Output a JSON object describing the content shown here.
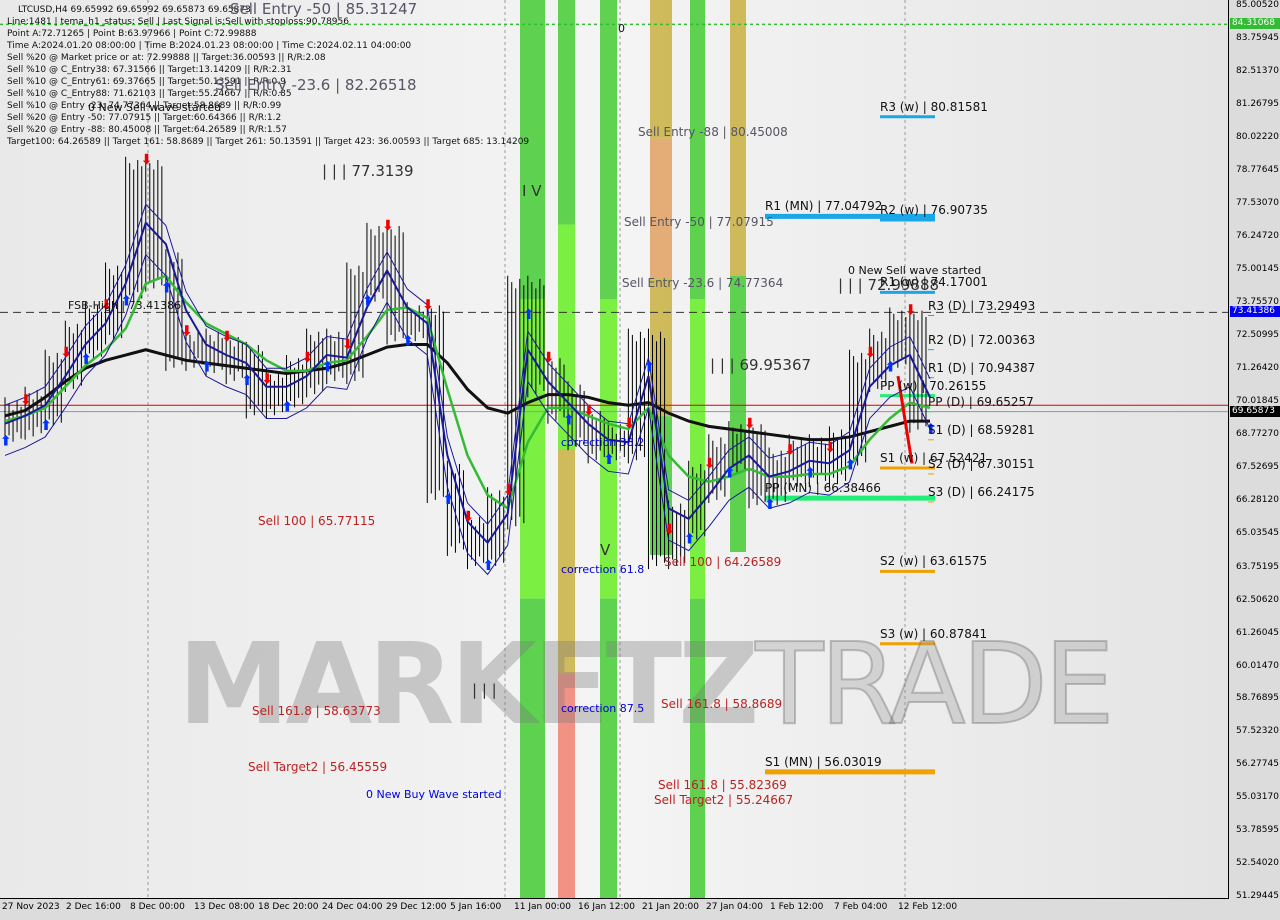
{
  "header": {
    "symbol_line": "LTCUSD,H4  69.65992 69.65992 69.65873 69.65873",
    "info_lines": [
      "Line:1481 | tema_h1_status: Sell | Last Signal is:Sell with stoploss:90.78956",
      "Point A:72.71265 | Point B:63.97966 | Point C:72.99888",
      "Time A:2024.01.20 08:00:00 | Time B:2024.01.23 08:00:00 | Time C:2024.02.11 04:00:00",
      "Sell %20 @ Market price or at: 72.99888 || Target:36.00593 || R/R:2.08",
      "Sell %10 @ C_Entry38: 67.31566 || Target:13.14209 || R/R:2.31",
      "Sell %10 @ C_Entry61: 69.37665 || Target:50.13591 || R/R:0.9",
      "Sell %10 @ C_Entry88: 71.62103 || Target:55.24667 || R/R:0.85",
      "Sell %10 @ Entry -23: 74.77364 || Target:58.8689 || R/R:0.99",
      "Sell %20 @ Entry -50: 77.07915 || Target:60.64366 || R/R:1.2",
      "Sell %20 @ Entry -88: 80.45008 || Target:64.26589 || R/R:1.57",
      "Target100: 64.26589 || Target 161: 58.8689 || Target 261: 50.13591 || Target 423: 36.00593 || Target 685: 13.14209"
    ]
  },
  "watermark": {
    "part1": "MARKETZ",
    "part2": "TRADE"
  },
  "annotations": [
    {
      "text": "Sell Entry -50 | 85.31247"
    },
    {
      "text": "Sell Entry -23.6 | 82.26518"
    },
    {
      "text": "0 New Sell wave started"
    },
    {
      "text": "FSB-High | 73.41386"
    },
    {
      "text": "| | | 77.3139"
    },
    {
      "text": "Sell Entry -88 | 80.45008"
    },
    {
      "text": "Sell Entry -50 | 77.07915"
    },
    {
      "text": "Sell Entry -23.6 | 74.77364"
    },
    {
      "text": "I V"
    },
    {
      "text": "0"
    },
    {
      "text": "| | | 69.95367"
    },
    {
      "text": "correction 38.2"
    },
    {
      "text": "correction 61.8"
    },
    {
      "text": "correction 87.5"
    },
    {
      "text": "V"
    },
    {
      "text": "Sell 100 | 65.77115"
    },
    {
      "text": "Sell 100 | 64.26589"
    },
    {
      "text": "Sell 161.8 | 58.63773"
    },
    {
      "text": "Sell Target2 | 56.45559"
    },
    {
      "text": "0 New Buy Wave started"
    },
    {
      "text": "| | |"
    },
    {
      "text": "Sell 161.8 | 58.8689"
    },
    {
      "text": "Sell 161.8 | 55.82369"
    },
    {
      "text": "Sell Target2 | 55.24667"
    },
    {
      "text": "0 New Sell wave started"
    },
    {
      "text": "| | | 72.99888"
    }
  ],
  "chart_data": {
    "type": "line",
    "title": "LTCUSD,H4",
    "ylim": [
      51.29445,
      85.0052
    ],
    "y_ticks": [
      "85.00520",
      "83.75945",
      "82.51370",
      "81.26795",
      "80.02220",
      "78.77645",
      "77.53070",
      "76.24720",
      "75.00145",
      "73.75570",
      "72.50995",
      "71.26420",
      "70.01845",
      "68.77270",
      "67.52695",
      "66.28120",
      "65.03545",
      "63.75195",
      "62.50620",
      "61.26045",
      "60.01470",
      "58.76895",
      "57.52320",
      "56.27745",
      "55.03170",
      "53.78595",
      "52.54020",
      "51.29445"
    ],
    "x_ticks": [
      "27 Nov 2023",
      "2 Dec 16:00",
      "8 Dec 00:00",
      "13 Dec 08:00",
      "18 Dec 20:00",
      "24 Dec 04:00",
      "29 Dec 12:00",
      "5 Jan 16:00",
      "11 Jan 00:00",
      "16 Jan 12:00",
      "21 Jan 20:00",
      "27 Jan 04:00",
      "1 Feb 12:00",
      "7 Feb 04:00",
      "12 Feb 12:00"
    ],
    "series": [
      {
        "key": "price",
        "color": "#000000",
        "values": [
          69.2,
          69.4,
          69.8,
          71.2,
          72.3,
          73,
          74.5,
          78.5,
          75,
          72,
          72,
          71.8,
          71.5,
          70.2,
          70.5,
          71,
          72,
          71.5,
          74.5,
          76,
          73,
          73,
          67,
          65,
          64.5,
          66,
          74,
          71,
          70,
          69,
          68.5,
          68.5,
          72,
          64.5,
          65.5,
          67,
          68,
          68.5,
          66.8,
          67.5,
          68,
          67.6,
          68.3,
          71.2,
          72,
          72.8,
          69.66
        ]
      },
      {
        "key": "ma-slow",
        "color": "#111111",
        "values": [
          69.5,
          69.7,
          70.2,
          70.8,
          71.3,
          71.6,
          71.8,
          72,
          71.8,
          71.6,
          71.5,
          71.4,
          71.3,
          71.2,
          71.1,
          71.2,
          71.3,
          71.5,
          71.8,
          72.1,
          72.2,
          72.2,
          71.5,
          70.5,
          69.8,
          69.6,
          70,
          70.3,
          70.3,
          70.2,
          70,
          69.9,
          70,
          69.6,
          69.3,
          69.1,
          69,
          68.9,
          68.8,
          68.7,
          68.6,
          68.6,
          68.7,
          68.9,
          69.1,
          69.3,
          69.3
        ]
      },
      {
        "key": "ma-green",
        "color": "#33bb33",
        "values": [
          69.3,
          69.5,
          69.8,
          70.6,
          71.4,
          72,
          72.8,
          74.5,
          74.8,
          73.8,
          73,
          72.6,
          72.2,
          71.6,
          71.2,
          71.2,
          71.5,
          71.6,
          72.5,
          73.5,
          73.6,
          73.2,
          70.5,
          68,
          66.5,
          66,
          68.5,
          69.8,
          69.8,
          69.5,
          69.2,
          69,
          69.8,
          68,
          67.2,
          67,
          67.2,
          67.5,
          67.2,
          67.2,
          67.3,
          67.3,
          67.6,
          68.6,
          69.4,
          70,
          69.8
        ]
      },
      {
        "key": "ma-blue",
        "color": "#1a1a99",
        "values": [
          69.2,
          69.5,
          69.9,
          71,
          72.2,
          73,
          74.5,
          76.8,
          76,
          73.5,
          72.2,
          71.8,
          71.5,
          70.6,
          70.6,
          71,
          71.8,
          71.7,
          73.6,
          75,
          73.6,
          73,
          68,
          65.5,
          64.7,
          65.8,
          72,
          70.8,
          70,
          69.2,
          68.6,
          68.5,
          71,
          66,
          65.6,
          66.5,
          67.5,
          68,
          67.2,
          67.4,
          67.8,
          67.7,
          68.2,
          70.6,
          71.4,
          71.8,
          70.2
        ]
      }
    ],
    "levels": [
      {
        "label": "R3 (w) | 80.81581",
        "price": 80.81581,
        "color": "#1aa7e8",
        "scope": "weekly"
      },
      {
        "label": "R2 (w) | 76.90735",
        "price": 76.90735,
        "color": "#1aa7e8",
        "scope": "weekly"
      },
      {
        "label": "R1 (w) | 74.17001",
        "price": 74.17001,
        "color": "#1aa7e8",
        "scope": "weekly"
      },
      {
        "label": "PP (w) | 70.26155",
        "price": 70.26155,
        "color": "#22ee77",
        "scope": "weekly"
      },
      {
        "label": "S1 (w) | 67.52421",
        "price": 67.52421,
        "color": "#f0a000",
        "scope": "weekly"
      },
      {
        "label": "S2 (w) | 63.61575",
        "price": 63.61575,
        "color": "#f0a000",
        "scope": "weekly"
      },
      {
        "label": "S3 (w) | 60.87841",
        "price": 60.87841,
        "color": "#f0a000",
        "scope": "weekly"
      },
      {
        "label": "R1 (MN) | 77.04792",
        "price": 77.04792,
        "color": "#1aa7e8",
        "scope": "monthly"
      },
      {
        "label": "PP (MN) | 66.38466",
        "price": 66.38466,
        "color": "#22ee77",
        "scope": "monthly"
      },
      {
        "label": "S1 (MN) | 56.03019",
        "price": 56.03019,
        "color": "#f0a000",
        "scope": "monthly"
      },
      {
        "label": "R3 (D) | 73.29493",
        "price": 73.29493,
        "color": "#1aa7e8",
        "scope": "daily"
      },
      {
        "label": "R2 (D) | 72.00363",
        "price": 72.00363,
        "color": "#1aa7e8",
        "scope": "daily"
      },
      {
        "label": "R1 (D) | 70.94387",
        "price": 70.94387,
        "color": "#1aa7e8",
        "scope": "daily"
      },
      {
        "label": "PP (D) | 69.65257",
        "price": 69.65257,
        "color": "#22ee77",
        "scope": "daily"
      },
      {
        "label": "S1 (D) | 68.59281",
        "price": 68.59281,
        "color": "#f0a000",
        "scope": "daily"
      },
      {
        "label": "S2 (D) | 67.30151",
        "price": 67.30151,
        "color": "#f0a000",
        "scope": "daily"
      },
      {
        "label": "S3 (D) | 66.24175",
        "price": 66.24175,
        "color": "#f0a000",
        "scope": "daily"
      }
    ],
    "price_tags": [
      {
        "value": "84.31068",
        "color": "#33bb33"
      },
      {
        "value": "73.41386",
        "color": "#0000ee"
      },
      {
        "value": "69.65873",
        "color": "#000000"
      }
    ]
  }
}
